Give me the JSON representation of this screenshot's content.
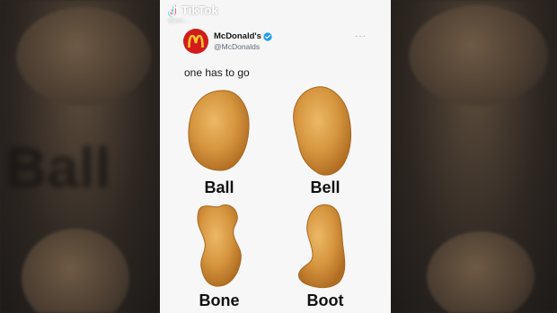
{
  "overlay": {
    "app_name": "TikTok",
    "username": "@acc..."
  },
  "tweet": {
    "display_name": "McDonald's",
    "handle": "@McDonalds",
    "text": "one has to go",
    "more": "···"
  },
  "image": {
    "labels": [
      "Ball",
      "Bell",
      "Bone",
      "Boot"
    ]
  },
  "background": {
    "left_word": "Ball"
  },
  "colors": {
    "brand_red": "#d21c1c",
    "arches_yellow": "#ffc72c",
    "verified_blue": "#1d9bf0",
    "nugget_gold": "#d89a46"
  }
}
